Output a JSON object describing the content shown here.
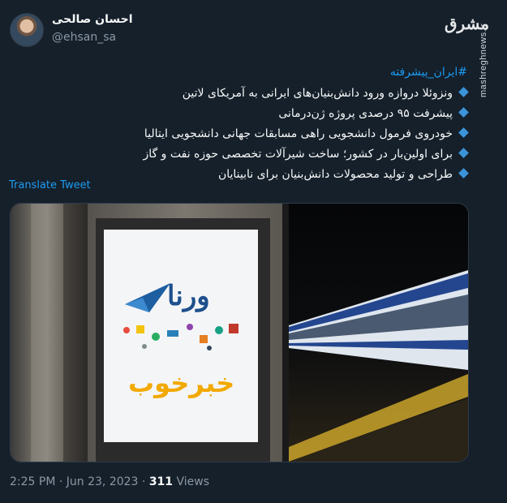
{
  "author": {
    "name": "احسان صالحی",
    "handle": "@ehsan_sa"
  },
  "watermark": {
    "logo": "مشرق",
    "site": "mashreghnews.ir"
  },
  "tweet": {
    "hashtag": "#ایران_پیشرفته",
    "lines": [
      "ونزوئلا دروازه ورود دانش‌بنیان‌های ایرانی به آمریکای لاتین",
      "پیشرفت ۹۵ درصدی پروژه ژن‌درمانی",
      "خودروی فرمول دانشجویی راهی مسابقات جهانی دانشجویی ایتالیا",
      "برای اولین‌بار در کشور؛ ساخت شیرآلات تخصصی حوزه نفت و گاز",
      "طراحی و تولید محصولات دانش‌بنیان برای نابینایان"
    ],
    "translate_label": "Translate Tweet"
  },
  "media": {
    "ad_brand": "ورنا",
    "ad_caption": "خبرخوب"
  },
  "meta": {
    "time": "2:25 PM",
    "separator": "·",
    "date": "Jun 23, 2023",
    "views_count": "311",
    "views_label": "Views"
  },
  "colors": {
    "background": "#15202b",
    "link": "#1d9bf0",
    "bullet": "#3b94d9",
    "muted": "#8b98a5"
  }
}
